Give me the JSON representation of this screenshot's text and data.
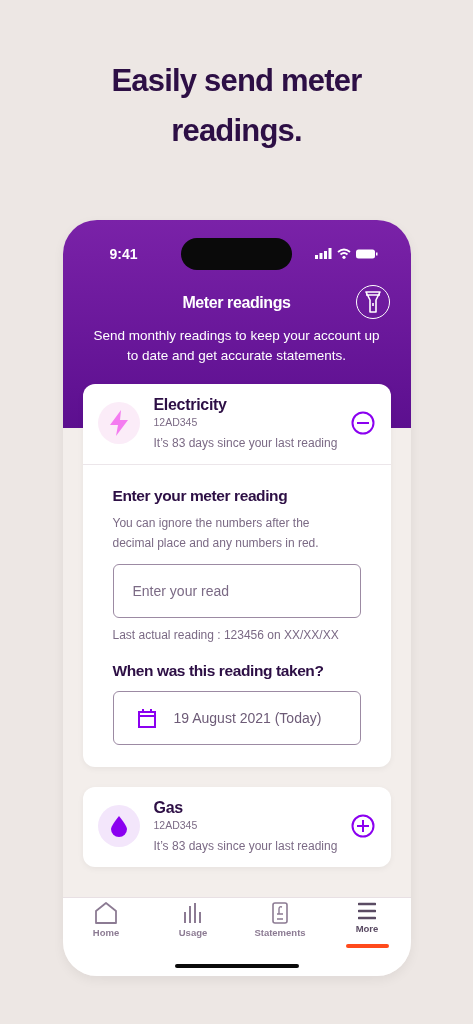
{
  "headline": "Easily send meter readings.",
  "status_bar": {
    "time": "9:41"
  },
  "header": {
    "title": "Meter readings",
    "subtitle": "Send monthly readings to keep your account up to date and get accurate statements."
  },
  "meters": [
    {
      "kind": "electricity",
      "name": "Electricity",
      "id": "12AD345",
      "since": "It’s 83 days since your last reading",
      "expanded": true,
      "form": {
        "heading": "Enter your meter reading",
        "hint": "You can ignore the numbers after the decimal place and any numbers in red.",
        "placeholder": "Enter your read",
        "last": "Last actual reading : 123456 on XX/XX/XX",
        "date_heading": "When was this reading taken?",
        "date": "19 August 2021 (Today)"
      }
    },
    {
      "kind": "gas",
      "name": "Gas",
      "id": "12AD345",
      "since": "It’s 83 days since your last reading",
      "expanded": false
    }
  ],
  "tabs": [
    {
      "kind": "home",
      "label": "Home",
      "selected": false
    },
    {
      "kind": "usage",
      "label": "Usage",
      "selected": false
    },
    {
      "kind": "statements",
      "label": "Statements",
      "selected": false
    },
    {
      "kind": "more",
      "label": "More",
      "selected": true
    }
  ]
}
